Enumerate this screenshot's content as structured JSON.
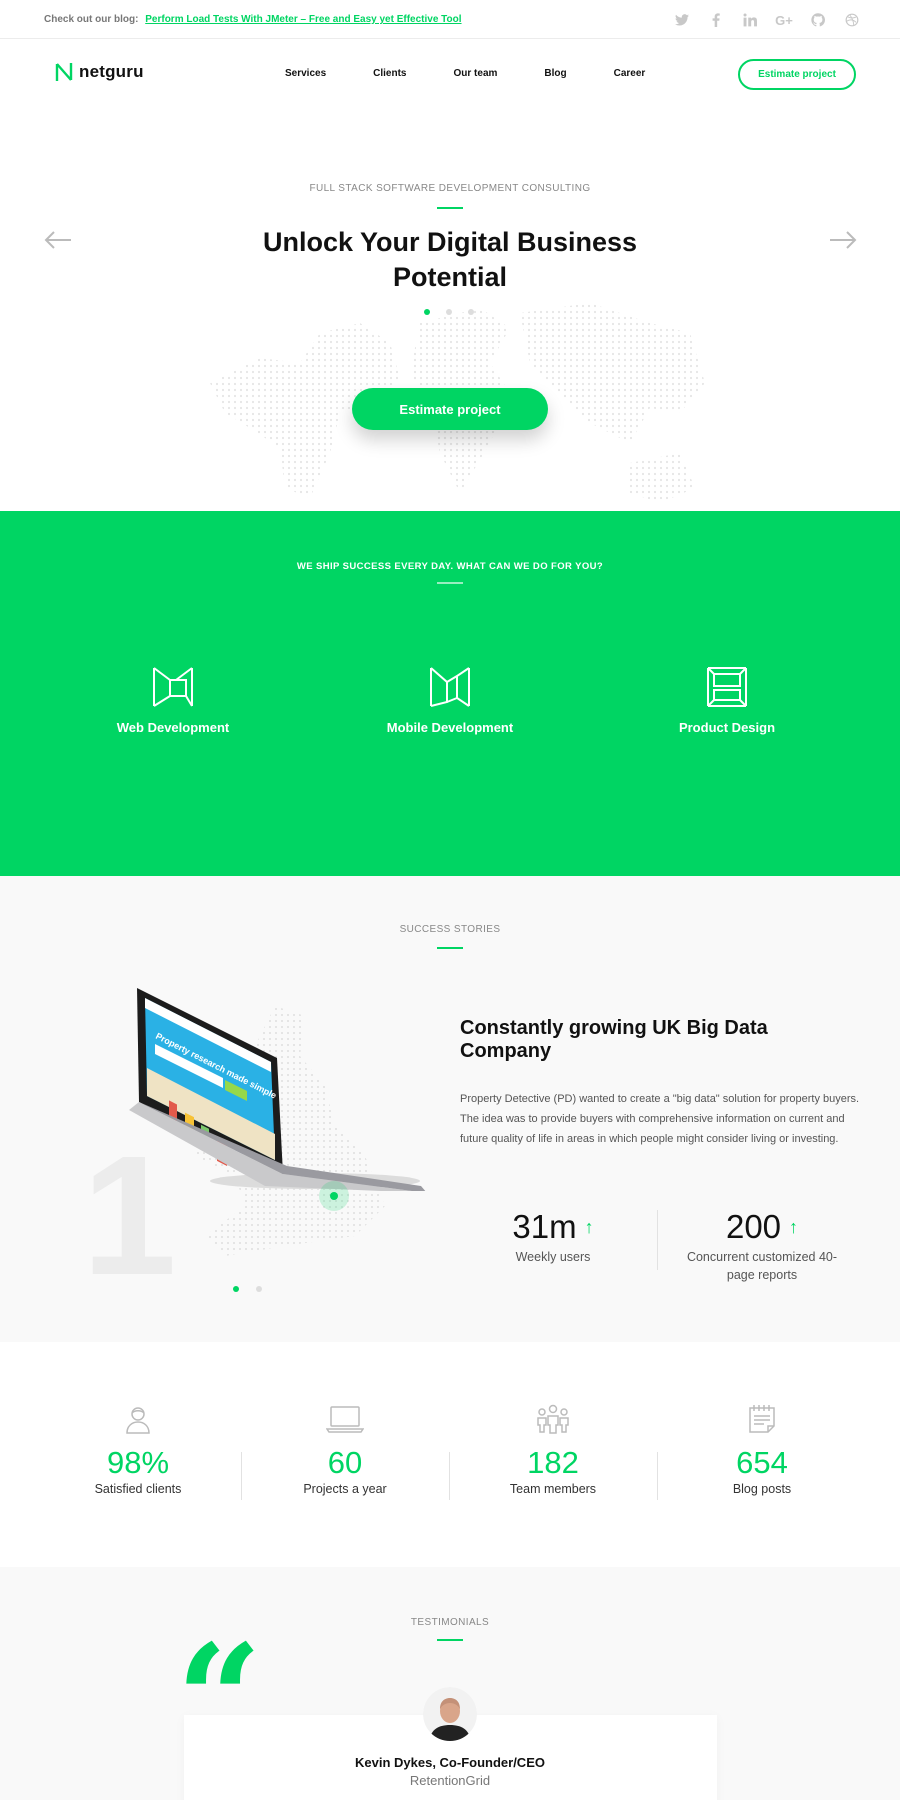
{
  "topbar": {
    "blog_prefix": "Check out our blog:",
    "blog_link": "Perform Load Tests With JMeter – Free and Easy yet Effective Tool",
    "social": [
      {
        "icon": "twitter-icon",
        "glyph": "t"
      },
      {
        "icon": "facebook-icon",
        "glyph": "f"
      },
      {
        "icon": "linkedin-icon",
        "glyph": "in"
      },
      {
        "icon": "google-plus-icon",
        "glyph": "G+"
      },
      {
        "icon": "github-icon",
        "glyph": "◎"
      },
      {
        "icon": "dribbble-icon",
        "glyph": "⊛"
      }
    ]
  },
  "nav": {
    "logo": "netguru",
    "menu": [
      "Services",
      "Clients",
      "Our team",
      "Blog",
      "Career"
    ],
    "cta": "Estimate project"
  },
  "hero": {
    "eyebrow": "FULL STACK SOFTWARE DEVELOPMENT CONSULTING",
    "title_line1": "Unlock Your Digital Business",
    "title_line2": "Potential",
    "cta": "Estimate project",
    "slide_active": 1,
    "slide_count": 3
  },
  "services": {
    "eyebrow": "WE SHIP SUCCESS EVERY DAY. WHAT CAN WE DO FOR YOU?",
    "items": [
      {
        "icon": "web-development-icon",
        "label": "Web Development"
      },
      {
        "icon": "mobile-development-icon",
        "label": "Mobile Development"
      },
      {
        "icon": "product-design-icon",
        "label": "Product Design"
      }
    ]
  },
  "success": {
    "eyebrow": "SUCCESS STORIES",
    "index": "1",
    "title": "Constantly growing UK Big Data Company",
    "description": "Property Detective (PD) wanted to create a \"big data\" solution for property buyers. The idea was to provide buyers with comprehensive information on current and future quality of life in areas in which people might consider living or investing.",
    "laptop_headline": "Property research made simple",
    "stats": [
      {
        "value": "31m",
        "caption": "Weekly users"
      },
      {
        "value": "200",
        "caption": "Concurrent customized 40-page reports"
      }
    ]
  },
  "numbers": [
    {
      "icon": "user-icon",
      "value": "98%",
      "caption": "Satisfied clients"
    },
    {
      "icon": "laptop-icon",
      "value": "60",
      "caption": "Projects a year"
    },
    {
      "icon": "team-icon",
      "value": "182",
      "caption": "Team members"
    },
    {
      "icon": "notepad-icon",
      "value": "654",
      "caption": "Blog posts"
    }
  ],
  "testimonials": {
    "eyebrow": "TESTIMONIALS",
    "quote_mark": "“",
    "name": "Kevin Dykes, Co-Founder/CEO",
    "company": "RetentionGrid"
  },
  "colors": {
    "brand_green": "#00d563",
    "text_dark": "#111111",
    "muted": "#888888",
    "light_bg": "#f9f9f9"
  }
}
